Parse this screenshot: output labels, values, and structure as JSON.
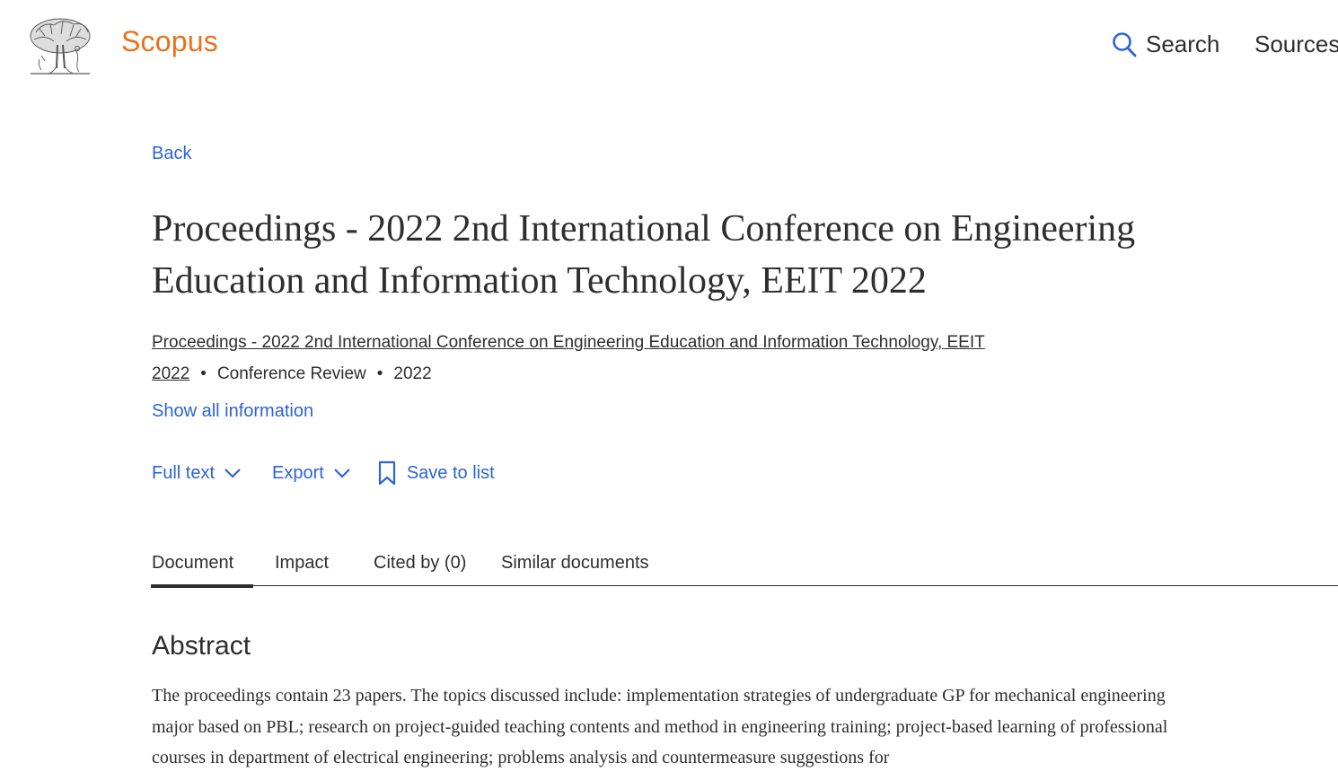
{
  "header": {
    "brand": "Scopus",
    "search_label": "Search",
    "sources_label": "Sources"
  },
  "nav": {
    "back_label": "Back"
  },
  "document": {
    "title": "Proceedings - 2022 2nd International Conference on Engineering Education and Information Technology, EEIT 2022",
    "source_title": "Proceedings - 2022 2nd International Conference on Engineering Education and Information Technology, EEIT 2022",
    "doc_type": "Conference Review",
    "year": "2022",
    "separator": "•",
    "show_all_label": "Show all information"
  },
  "actions": {
    "full_text_label": "Full text",
    "export_label": "Export",
    "save_label": "Save to list"
  },
  "tabs": [
    {
      "label": "Document",
      "active": true
    },
    {
      "label": "Impact",
      "active": false
    },
    {
      "label": "Cited by (0)",
      "active": false
    },
    {
      "label": "Similar documents",
      "active": false
    }
  ],
  "abstract": {
    "heading": "Abstract",
    "text": "The proceedings contain 23 papers. The topics discussed include: implementation strategies of undergraduate GP for mechanical engineering major based on PBL; research on project-guided teaching contents and method in engineering training; project-based learning of professional courses in department of electrical engineering; problems analysis and countermeasure suggestions for"
  },
  "colors": {
    "brand": "#e9711c",
    "link": "#2e63d2",
    "text": "#2e2e2e"
  },
  "icons": {
    "logo": "elsevier-tree-logo",
    "search": "search-icon",
    "chevron": "chevron-down-icon",
    "bookmark": "bookmark-icon"
  }
}
